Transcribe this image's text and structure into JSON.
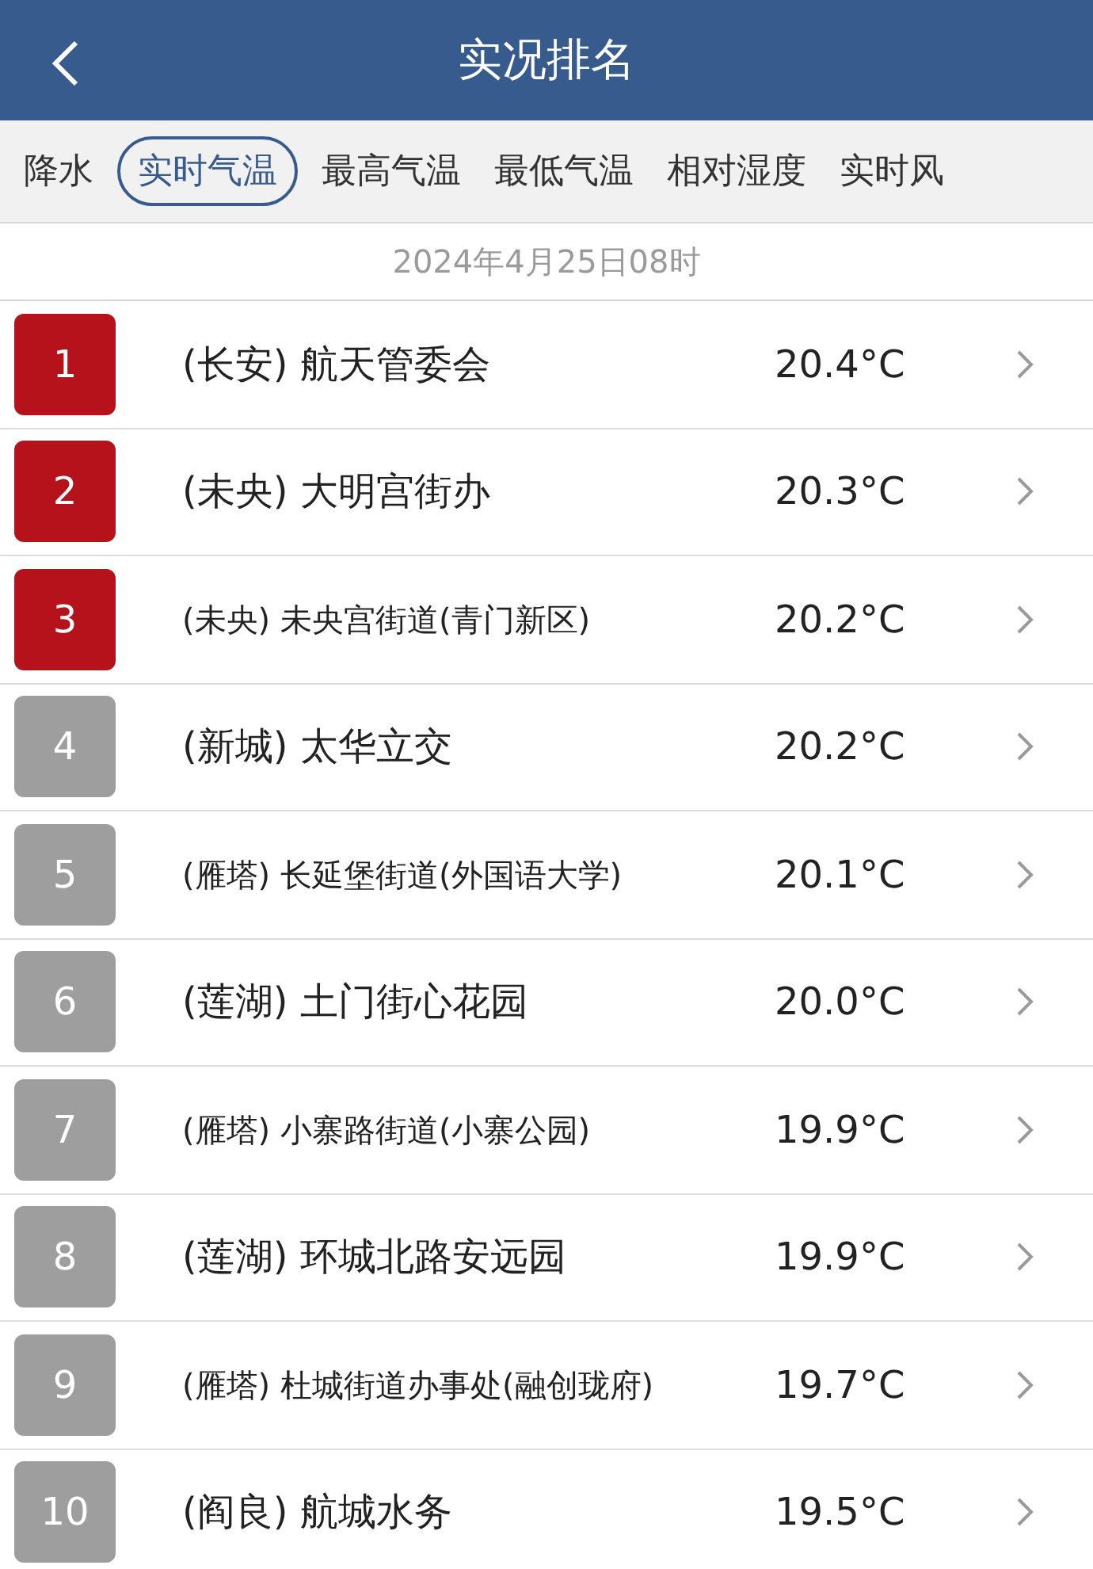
{
  "header": {
    "title": "实况排名"
  },
  "tabs": [
    {
      "label": "降水",
      "selected": false
    },
    {
      "label": "实时气温",
      "selected": true
    },
    {
      "label": "最高气温",
      "selected": false
    },
    {
      "label": "最低气温",
      "selected": false
    },
    {
      "label": "相对湿度",
      "selected": false
    },
    {
      "label": "实时风",
      "selected": false
    }
  ],
  "timestamp": "2024年4月25日08时",
  "rows": [
    {
      "rank": "1",
      "color": "#b5121b",
      "district": "(长安)",
      "station": "航天管委会",
      "temperature": "20.4°C"
    },
    {
      "rank": "2",
      "color": "#b5121b",
      "district": "(未央)",
      "station": "大明宫街办",
      "temperature": "20.3°C"
    },
    {
      "rank": "3",
      "color": "#b5121b",
      "district": "(未央)",
      "station": "未央宫街道(青门新区)",
      "temperature": "20.2°C"
    },
    {
      "rank": "4",
      "color": "#9e9e9e",
      "district": "(新城)",
      "station": "太华立交",
      "temperature": "20.2°C"
    },
    {
      "rank": "5",
      "color": "#9e9e9e",
      "district": "(雁塔)",
      "station": "长延堡街道(外国语大学)",
      "temperature": "20.1°C"
    },
    {
      "rank": "6",
      "color": "#9e9e9e",
      "district": "(莲湖)",
      "station": "土门街心花园",
      "temperature": "20.0°C"
    },
    {
      "rank": "7",
      "color": "#9e9e9e",
      "district": "(雁塔)",
      "station": "小寨路街道(小寨公园)",
      "temperature": "19.9°C"
    },
    {
      "rank": "8",
      "color": "#9e9e9e",
      "district": "(莲湖)",
      "station": "环城北路安远园",
      "temperature": "19.9°C"
    },
    {
      "rank": "9",
      "color": "#9e9e9e",
      "district": "(雁塔)",
      "station": "杜城街道办事处(融创珑府)",
      "temperature": "19.7°C"
    },
    {
      "rank": "10",
      "color": "#9e9e9e",
      "district": "(阎良)",
      "station": "航城水务",
      "temperature": "19.5°C"
    }
  ]
}
